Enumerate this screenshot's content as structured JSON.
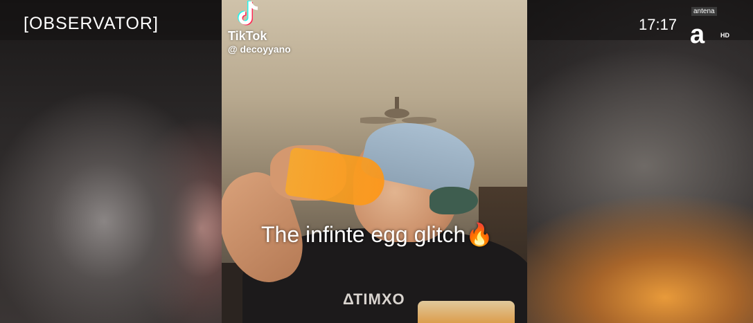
{
  "broadcast": {
    "logo_text": "[OBSERVATOR]",
    "clock": "17:17",
    "channel_name": "antena",
    "channel_glyph": "a",
    "hd_label": "HD"
  },
  "video": {
    "source_name": "TikTok",
    "handle": "@ decoyyano",
    "caption": "The infinte egg glitch",
    "caption_emoji": "🔥",
    "shirt_text": "ΔΤΙΜΧΟ"
  },
  "colors": {
    "caption_text": "#ffffff",
    "cup_liquid": "#f5a623",
    "cap": "#a9bed0"
  }
}
